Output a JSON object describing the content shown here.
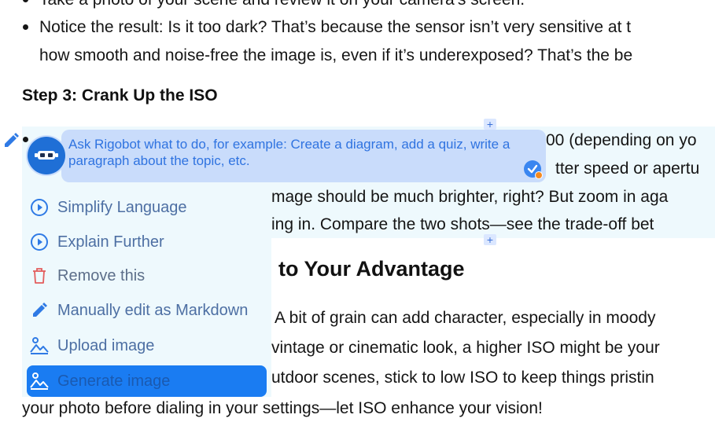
{
  "content": {
    "top_partial_line": "Take a photo of your scene and review it on your camera’s screen.",
    "notice_line_1": "Notice the result: Is it too dark? That’s because the sensor isn’t very sensitive at t",
    "notice_line_2": "how smooth and noise-free the image is, even if it’s underexposed? That’s the be",
    "step3_heading": "Step 3: Crank Up the ISO",
    "iso_line_1_tail": "00 (depending on yo",
    "iso_line_2_tail": "tter speed or apertu",
    "iso_line_3_tail": "mage should be much brighter, right? But zoom in aga",
    "iso_line_4_tail": "ing in. Compare the two shots—see the trade-off bet",
    "section_heading_tail": "to Your Advantage",
    "para_line_1_tail": "A bit of grain can add character, especially in moody",
    "para_line_2_tail": "vintage or cinematic look, a higher ISO might be your",
    "para_line_3_tail": "utdoor scenes, stick to low ISO to keep things pristin",
    "para_line_4": "your photo before dialing in your settings—let ISO enhance your vision!"
  },
  "editor": {
    "prompt_placeholder": "Ask Rigobot what to do, for example: Create a diagram, add a quiz, write a paragraph about the topic, etc.",
    "add_block_symbol": "+"
  },
  "menu": {
    "items": [
      {
        "label": "Simplify Language",
        "icon": "play-circle-icon"
      },
      {
        "label": "Explain Further",
        "icon": "play-circle-icon"
      },
      {
        "label": "Remove this",
        "icon": "trash-icon"
      },
      {
        "label": "Manually edit as Markdown",
        "icon": "pencil-icon"
      },
      {
        "label": "Upload image",
        "icon": "image-icon"
      },
      {
        "label": "Generate image",
        "icon": "image-icon"
      }
    ]
  },
  "colors": {
    "accent": "#1a7cf2",
    "menu_text": "#4d6fa3",
    "danger_icon": "#e35d5d",
    "prompt_bg": "#c9dcfb",
    "block_highlight": "#eef9fd"
  }
}
